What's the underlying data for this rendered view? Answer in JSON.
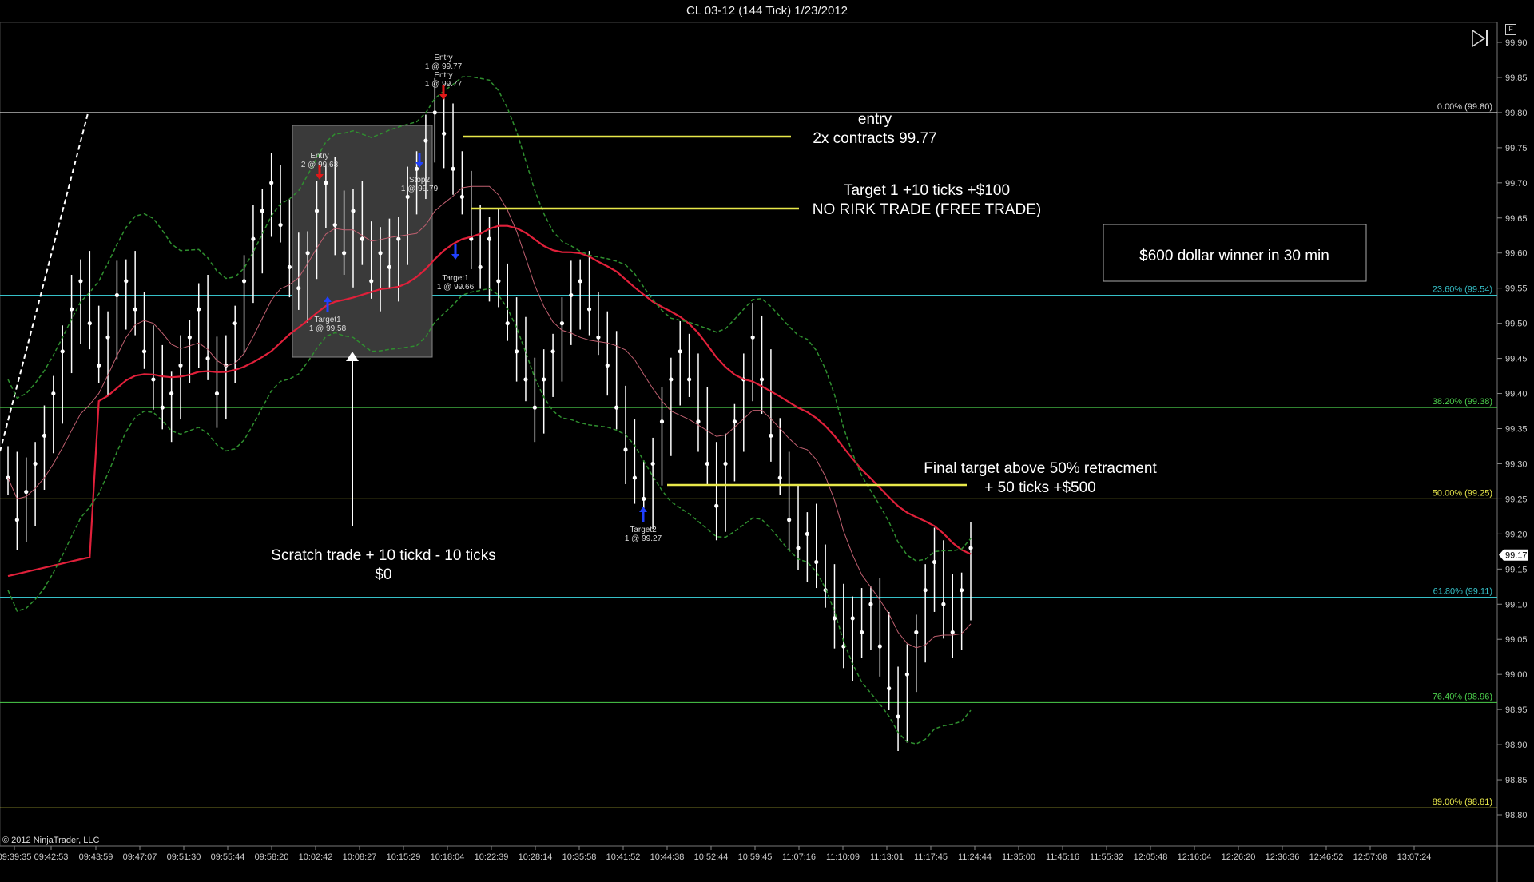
{
  "window": {
    "title": "CL 03-12 (144 Tick)  1/23/2012"
  },
  "copyright": "© 2012 NinjaTrader, LLC",
  "current_price_label": "99.17",
  "chart_data": {
    "type": "candlestick",
    "symbol": "CL 03-12",
    "interval": "144 Tick",
    "date": "1/23/2012",
    "ylim": [
      98.76,
      99.91
    ],
    "y_ticks": [
      "99.90",
      "99.85",
      "99.80",
      "99.75",
      "99.70",
      "99.65",
      "99.60",
      "99.55",
      "99.50",
      "99.45",
      "99.40",
      "99.35",
      "99.30",
      "99.25",
      "99.20",
      "99.15",
      "99.10",
      "99.05",
      "99.00",
      "98.95",
      "98.90",
      "98.85",
      "98.80"
    ],
    "x_ticks": [
      "09:39:35",
      "09:42:53",
      "09:43:59",
      "09:47:07",
      "09:51:30",
      "09:55:44",
      "09:58:20",
      "10:02:42",
      "10:08:27",
      "10:15:29",
      "10:18:04",
      "10:22:39",
      "10:28:14",
      "10:35:58",
      "10:41:52",
      "10:44:38",
      "10:52:44",
      "10:59:45",
      "11:07:16",
      "11:10:09",
      "11:13:01",
      "11:17:45",
      "11:24:44",
      "11:35:00",
      "11:45:16",
      "11:55:32",
      "12:05:48",
      "12:16:04",
      "12:26:20",
      "12:36:36",
      "12:46:52",
      "12:57:08",
      "13:07:24"
    ],
    "fib_levels": [
      {
        "label": "0.00% (99.80)",
        "price": 99.8,
        "color": "#dddddd"
      },
      {
        "label": "23.60% (99.54)",
        "price": 99.54,
        "color": "#36c0c8"
      },
      {
        "label": "38.20% (99.38)",
        "price": 99.38,
        "color": "#4ccf4c"
      },
      {
        "label": "50.00% (99.25)",
        "price": 99.25,
        "color": "#e8e84a"
      },
      {
        "label": "61.80% (99.11)",
        "price": 99.11,
        "color": "#36c0c8"
      },
      {
        "label": "76.40% (98.96)",
        "price": 98.96,
        "color": "#4ccf4c"
      },
      {
        "label": "89.00% (98.81)",
        "price": 98.81,
        "color": "#e8e84a"
      }
    ],
    "closes": [
      99.28,
      99.22,
      99.26,
      99.3,
      99.34,
      99.4,
      99.46,
      99.52,
      99.56,
      99.5,
      99.44,
      99.48,
      99.54,
      99.56,
      99.52,
      99.46,
      99.42,
      99.38,
      99.4,
      99.44,
      99.48,
      99.52,
      99.45,
      99.4,
      99.44,
      99.5,
      99.56,
      99.62,
      99.66,
      99.7,
      99.64,
      99.58,
      99.55,
      99.6,
      99.66,
      99.7,
      99.64,
      99.6,
      99.66,
      99.62,
      99.56,
      99.6,
      99.58,
      99.62,
      99.68,
      99.72,
      99.76,
      99.8,
      99.77,
      99.72,
      99.68,
      99.62,
      99.58,
      99.62,
      99.56,
      99.5,
      99.46,
      99.42,
      99.38,
      99.42,
      99.46,
      99.5,
      99.54,
      99.56,
      99.52,
      99.48,
      99.44,
      99.38,
      99.32,
      99.28,
      99.25,
      99.3,
      99.36,
      99.42,
      99.46,
      99.42,
      99.36,
      99.3,
      99.24,
      99.3,
      99.36,
      99.42,
      99.48,
      99.42,
      99.34,
      99.28,
      99.22,
      99.18,
      99.2,
      99.16,
      99.12,
      99.08,
      99.04,
      99.08,
      99.06,
      99.1,
      99.04,
      98.98,
      98.94,
      99.0,
      99.06,
      99.12,
      99.16,
      99.1,
      99.06,
      99.12,
      99.18
    ],
    "annotations": [
      {
        "lines": [
          "entry",
          "2x contracts 99.77"
        ]
      },
      {
        "lines": [
          "Target 1 +10 ticks +$100",
          "NO RIRK TRADE (FREE TRADE)"
        ]
      },
      {
        "lines": [
          "$600 dollar winner in 30 min"
        ]
      },
      {
        "lines": [
          "Final target above 50% retracment",
          "+ 50 ticks +$500"
        ]
      },
      {
        "lines": [
          "Scratch trade + 10 tickd - 10 ticks",
          "$0"
        ]
      }
    ],
    "trade_markers": [
      {
        "lines": [
          "Entry",
          "1 @ 99.77",
          "Entry",
          "1 @ 99.77"
        ]
      },
      {
        "lines": [
          "Entry",
          "2 @ 99.68"
        ]
      },
      {
        "lines": [
          "Stop2",
          "1 @ 99.79"
        ]
      },
      {
        "lines": [
          "Target1",
          "1 @ 99.66"
        ]
      },
      {
        "lines": [
          "Target1",
          "1 @ 99.58"
        ]
      },
      {
        "lines": [
          "Target2",
          "1 @ 99.27"
        ]
      }
    ],
    "colors": {
      "candle": "#ffffff",
      "sma": "#e0203a",
      "ema": "#c06070",
      "bands": "#2f8f2f",
      "annotation_line": "#e8e84a"
    }
  }
}
